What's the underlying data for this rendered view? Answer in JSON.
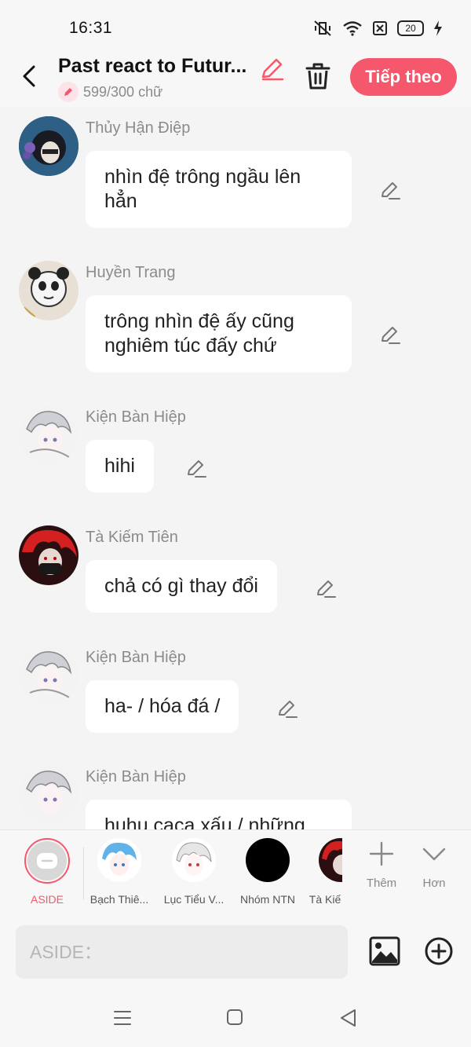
{
  "status": {
    "time": "16:31",
    "battery": "20"
  },
  "header": {
    "title": "Past react to Futur...",
    "word_count": "599/300 chữ",
    "next_label": "Tiếp theo"
  },
  "messages": [
    {
      "sender": "Thủy Hận Điệp",
      "text": "nhìn đệ trông ngầu lên hẳn"
    },
    {
      "sender": "Huyền Trang",
      "text": "trông nhìn đệ ấy cũng nghiêm túc đấy chứ"
    },
    {
      "sender": "Kiện Bàn Hiệp",
      "text": "hihi"
    },
    {
      "sender": "Tà Kiếm Tiên",
      "text": "chả có gì thay đổi"
    },
    {
      "sender": "Kiện Bàn Hiệp",
      "text": "ha- / hóa đá /"
    },
    {
      "sender": "Kiện Bàn Hiệp",
      "text": "huhu caca xấu / những"
    }
  ],
  "characters": [
    {
      "label": "ASIDE"
    },
    {
      "label": "Bạch Thiê..."
    },
    {
      "label": "Lục Tiểu V..."
    },
    {
      "label": "Nhóm NTN"
    },
    {
      "label": "Tà Kiế"
    }
  ],
  "tools": {
    "add_label": "Thêm",
    "more_label": "Hơn"
  },
  "input": {
    "placeholder": "ASIDE："
  },
  "colors": {
    "accent": "#f5576c",
    "background": "#f4f4f4",
    "bubble": "#ffffff"
  },
  "icons": [
    "back-icon",
    "pencil-icon",
    "trash-icon",
    "image-icon",
    "plus-circle-icon",
    "menu-icon",
    "home-icon",
    "back-triangle-icon"
  ]
}
